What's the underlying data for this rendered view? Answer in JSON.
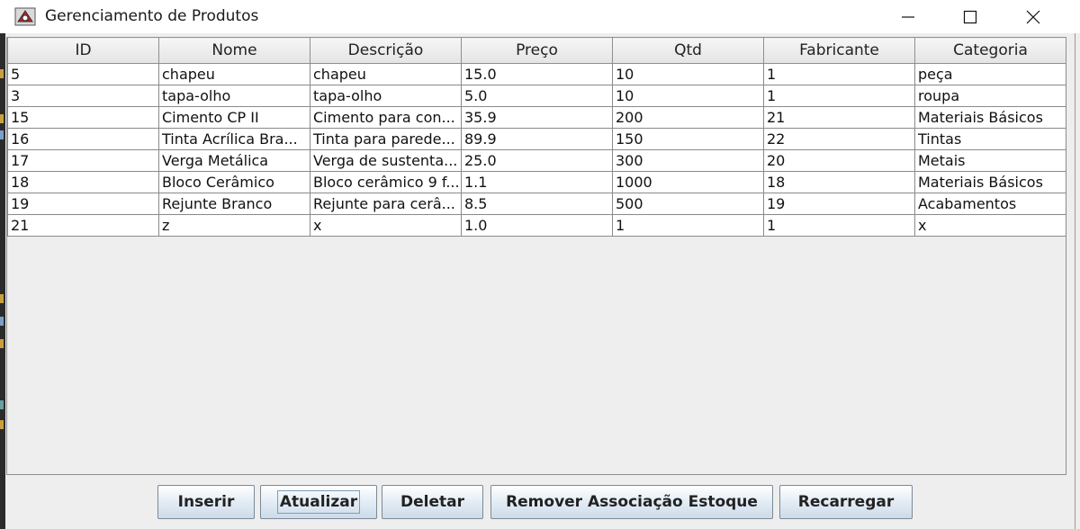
{
  "window": {
    "title": "Gerenciamento de Produtos",
    "icon": "java-app-icon",
    "controls": [
      "minimize-icon",
      "maximize-icon",
      "close-icon"
    ]
  },
  "table": {
    "headers": [
      "ID",
      "Nome",
      "Descrição",
      "Preço",
      "Qtd",
      "Fabricante",
      "Categoria"
    ],
    "rows": [
      [
        "5",
        "chapeu",
        "chapeu",
        "15.0",
        "10",
        "1",
        "peça"
      ],
      [
        "3",
        "tapa-olho",
        "tapa-olho",
        "5.0",
        "10",
        "1",
        "roupa"
      ],
      [
        "15",
        "Cimento CP II",
        "Cimento para con...",
        "35.9",
        "200",
        "21",
        "Materiais Básicos"
      ],
      [
        "16",
        "Tinta Acrílica Bra...",
        "Tinta para parede...",
        "89.9",
        "150",
        "22",
        "Tintas"
      ],
      [
        "17",
        "Verga Metálica",
        "Verga de sustenta...",
        "25.0",
        "300",
        "20",
        "Metais"
      ],
      [
        "18",
        "Bloco Cerâmico",
        "Bloco cerâmico 9 f...",
        "1.1",
        "1000",
        "18",
        "Materiais Básicos"
      ],
      [
        "19",
        "Rejunte Branco",
        "Rejunte para cerâ...",
        "8.5",
        "500",
        "19",
        "Acabamentos"
      ],
      [
        "21",
        "z",
        "x",
        "1.0",
        "1",
        "1",
        "x"
      ]
    ]
  },
  "buttons": {
    "inserir": "Inserir",
    "atualizar": "Atualizar",
    "deletar": "Deletar",
    "remover": "Remover Associação Estoque",
    "recarregar": "Recarregar"
  }
}
